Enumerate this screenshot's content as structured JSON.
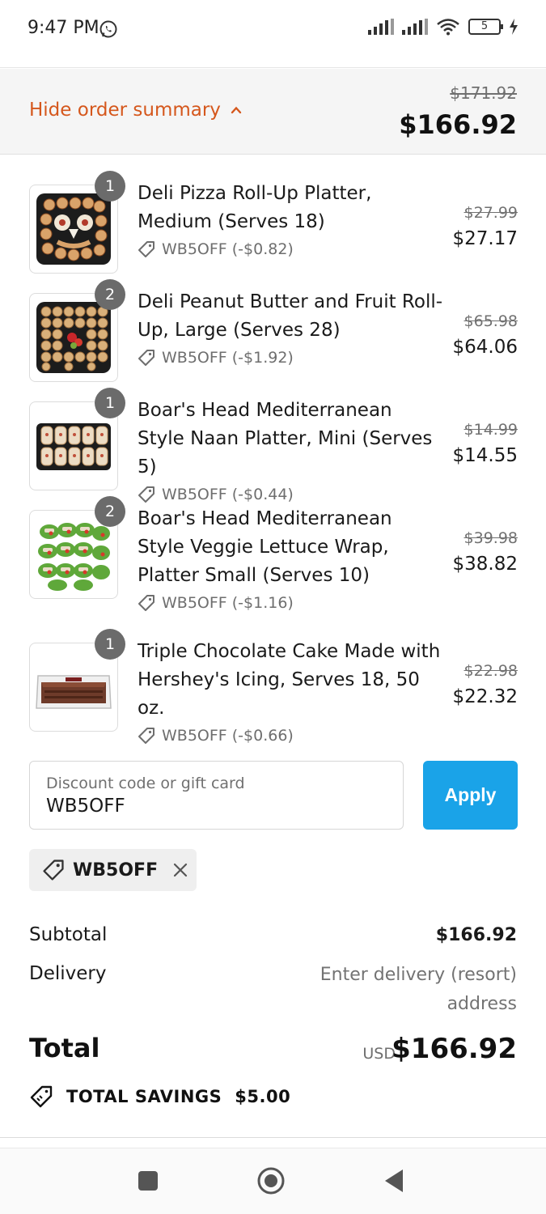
{
  "status_bar": {
    "time": "9:47 PM",
    "battery": "5",
    "icons": [
      "whatsapp-icon",
      "signal-icon",
      "signal-icon",
      "wifi-icon",
      "battery-icon",
      "charging-icon"
    ]
  },
  "summary_header": {
    "toggle_label": "Hide order summary",
    "original_total": "$171.92",
    "total": "$166.92"
  },
  "products": [
    {
      "qty": "1",
      "name": "Deli Pizza Roll-Up Platter, Medium (Serves 18)",
      "discount": "WB5OFF (-$0.82)",
      "original_price": "$27.99",
      "price": "$27.17",
      "image": "pizza-rollup-platter"
    },
    {
      "qty": "2",
      "name": "Deli Peanut Butter and Fruit Roll-Up, Large (Serves 28)",
      "discount": "WB5OFF (-$1.92)",
      "original_price": "$65.98",
      "price": "$64.06",
      "image": "peanut-butter-rollup-platter"
    },
    {
      "qty": "1",
      "name": "Boar's Head Mediterranean Style Naan Platter, Mini (Serves 5)",
      "discount": "WB5OFF (-$0.44)",
      "original_price": "$14.99",
      "price": "$14.55",
      "image": "naan-platter"
    },
    {
      "qty": "2",
      "name": "Boar's Head Mediterranean Style Veggie Lettuce Wrap, Platter Small (Serves 10)",
      "discount": "WB5OFF (-$1.16)",
      "original_price": "$39.98",
      "price": "$38.82",
      "image": "lettuce-wrap-platter"
    },
    {
      "qty": "1",
      "name": "Triple Chocolate Cake Made with Hershey's Icing, Serves 18, 50 oz.",
      "discount": "WB5OFF (-$0.66)",
      "original_price": "$22.98",
      "price": "$22.32",
      "image": "chocolate-cake"
    }
  ],
  "discount_input": {
    "placeholder": "Discount code or gift card",
    "value": "WB5OFF",
    "apply_label": "Apply"
  },
  "applied_code": {
    "label": "WB5OFF"
  },
  "totals": {
    "subtotal_label": "Subtotal",
    "subtotal_value": "$166.92",
    "delivery_label": "Delivery",
    "delivery_value": "Enter delivery (resort) address",
    "total_label": "Total",
    "currency": "USD",
    "total_value": "$166.92",
    "savings_label": "TOTAL SAVINGS",
    "savings_value": "$5.00"
  },
  "colors": {
    "accent_orange": "#d5571c",
    "apply_blue": "#1aa3e8",
    "qty_badge": "#6b6b6b"
  }
}
